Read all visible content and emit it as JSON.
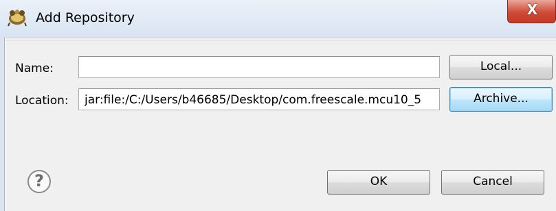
{
  "window": {
    "title": "Add Repository",
    "close_glyph": "X"
  },
  "form": {
    "name_label": "Name:",
    "name_value": "",
    "location_label": "Location:",
    "location_value": "jar:file:/C:/Users/b46685/Desktop/com.freescale.mcu10_5"
  },
  "buttons": {
    "local": "Local...",
    "archive": "Archive...",
    "ok": "OK",
    "cancel": "Cancel"
  },
  "help": {
    "glyph": "?"
  },
  "icons": {
    "app": "eclipse-plugin-icon",
    "help": "help-icon",
    "close": "close-icon"
  },
  "colors": {
    "close_button": "#cf4a35",
    "focused_button": "#bee6fd",
    "dialog_background": "#f0f0f0"
  }
}
